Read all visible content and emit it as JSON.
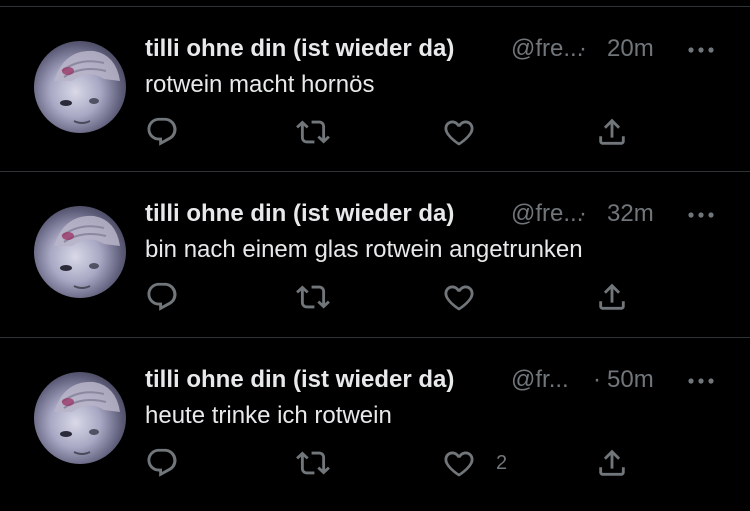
{
  "tweets": [
    {
      "name": "tilli ohne din (ist wieder da)",
      "handle": "@fre...",
      "separator": "·",
      "time": "20m",
      "text": "rotwein macht hornös",
      "like_count": ""
    },
    {
      "name": "tilli ohne din (ist wieder da)",
      "handle": "@fre...",
      "separator": "·",
      "time": "32m",
      "text": "bin nach einem glas rotwein angetrunken",
      "like_count": ""
    },
    {
      "name": "tilli ohne din (ist wieder da)",
      "handle": "@fr...",
      "separator": "·",
      "time": "50m",
      "text": "heute trinke ich rotwein",
      "like_count": "2"
    }
  ],
  "icons": {
    "reply": "reply-icon",
    "retweet": "retweet-icon",
    "like": "heart-icon",
    "share": "share-icon",
    "more": "more-icon"
  },
  "colors": {
    "background": "#000000",
    "text": "#e7e9ea",
    "secondary": "#71767b",
    "divider": "#2f3336"
  }
}
